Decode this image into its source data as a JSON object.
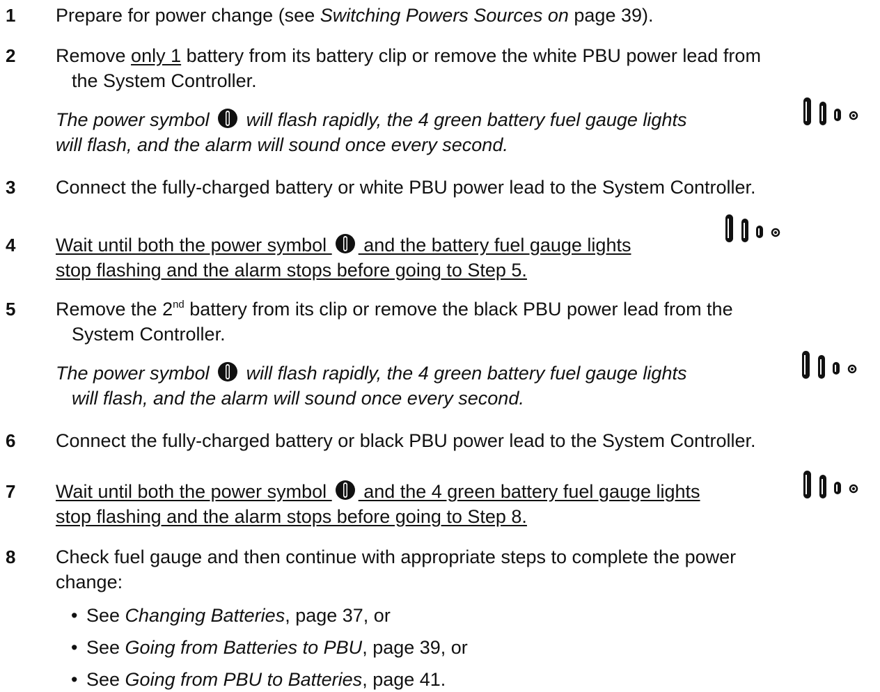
{
  "steps": [
    {
      "number": "1",
      "parts": [
        "Prepare for power change (see ",
        "Switching Powers Sources on",
        " page 39)."
      ]
    },
    {
      "number": "2",
      "line1": [
        "Remove ",
        "only 1",
        " battery from its battery clip or remove the white PBU power lead from"
      ],
      "line2": "the System Controller.",
      "note1a": "The power symbol ",
      "note1b": " will flash rapidly, the 4 green battery fuel gauge lights",
      "note2": "will flash, and the alarm will sound once every second."
    },
    {
      "number": "3",
      "text": "Connect the fully-charged battery or white PBU power lead to the System Controller."
    },
    {
      "number": "4",
      "line1a": "Wait until both the power symbol ",
      "line1b": " and the battery fuel gauge lights ",
      "line2": "stop flashing and the alarm stops before going to Step 5."
    },
    {
      "number": "5",
      "line1": [
        "Remove the 2",
        "nd",
        " battery from its clip or remove the black PBU power lead from the"
      ],
      "line2": "System Controller.",
      "note1a": "The power symbol ",
      "note1b": " will flash rapidly, the 4 green battery fuel gauge lights",
      "note2": "will flash, and the alarm will sound once every second."
    },
    {
      "number": "6",
      "text": "Connect the fully-charged battery or black PBU power lead to the System Controller."
    },
    {
      "number": "7",
      "line1a": "Wait until both the power symbol ",
      "line1b": " and the 4 green battery fuel gauge lights ",
      "line2": "stop flashing and the alarm stops before going to Step 8."
    },
    {
      "number": "8",
      "line1": "Check fuel gauge and then continue with appropriate steps to complete the power",
      "line2": "change:",
      "bullets": [
        {
          "prefix": "See ",
          "title": "Changing Batteries",
          "suffix": ", page 37, or"
        },
        {
          "prefix": "See ",
          "title": "Going from Batteries to PBU",
          "suffix": ", page 39, or"
        },
        {
          "prefix": "See ",
          "title": "Going from PBU to Batteries",
          "suffix": ", page 41."
        }
      ]
    }
  ],
  "bullet_glyph": "•",
  "icons": {
    "power": "power-icon",
    "gauge": "battery-fuel-gauge-icon"
  },
  "colors": {
    "text": "#111111",
    "icon": "#111111"
  }
}
